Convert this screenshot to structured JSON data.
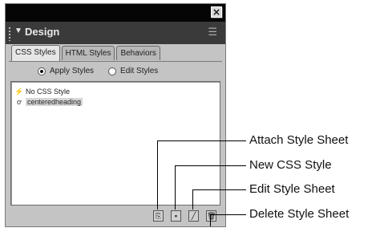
{
  "panel": {
    "close_glyph": "×",
    "header_arrow": "▼",
    "header_title": "Design",
    "menu_glyph": "☰",
    "tabs": [
      "CSS Styles",
      "HTML Styles",
      "Behaviors"
    ],
    "radios": [
      {
        "label": "Apply Styles",
        "checked": true
      },
      {
        "label": "Edit Styles",
        "checked": false
      }
    ],
    "styles": [
      {
        "icon": "no-style-icon",
        "glyph": "⚡",
        "label": "No CSS Style"
      },
      {
        "icon": "style-icon",
        "glyph": "ơ",
        "label": "centeredheading"
      }
    ],
    "toolbar_glyphs": [
      "⎘",
      "▪",
      "╱",
      "🗑"
    ]
  },
  "callouts": [
    "Attach Style Sheet",
    "New CSS Style",
    "Edit Style Sheet",
    "Delete Style Sheet"
  ]
}
